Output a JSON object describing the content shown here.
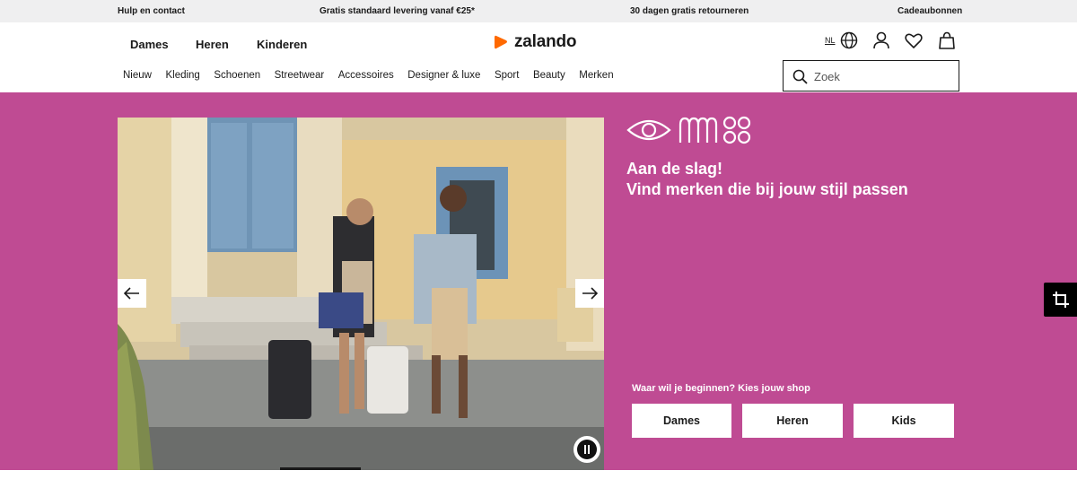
{
  "topbar": {
    "help": "Hulp en contact",
    "shipping": "Gratis standaard levering vanaf €25*",
    "returns": "30 dagen gratis retourneren",
    "gift": "Cadeaubonnen"
  },
  "header": {
    "genders": [
      "Dames",
      "Heren",
      "Kinderen"
    ],
    "logo_text": "zalando",
    "language": "NL",
    "categories": [
      "Nieuw",
      "Kleding",
      "Schoenen",
      "Streetwear",
      "Accessoires",
      "Designer & luxe",
      "Sport",
      "Beauty",
      "Merken"
    ],
    "search_placeholder": "Zoek"
  },
  "icons": {
    "logo": "zalando-logo-icon",
    "language": "globe-icon",
    "account": "user-icon",
    "wishlist": "heart-icon",
    "cart": "bag-icon",
    "search": "search-icon",
    "prev": "arrow-left-icon",
    "next": "arrow-right-icon",
    "pause": "pause-icon",
    "side_tool": "crop-icon"
  },
  "hero": {
    "headline_line1": "Aan de slag!",
    "headline_line2": "Vind merken die bij jouw stijl passen",
    "prompt": "Waar wil je beginnen? Kies jouw shop",
    "shops": [
      "Dames",
      "Heren",
      "Kids"
    ]
  },
  "colors": {
    "hero_bg": "#bf4b93",
    "brand_orange": "#ff6900",
    "topbar_bg": "#efeff0"
  }
}
